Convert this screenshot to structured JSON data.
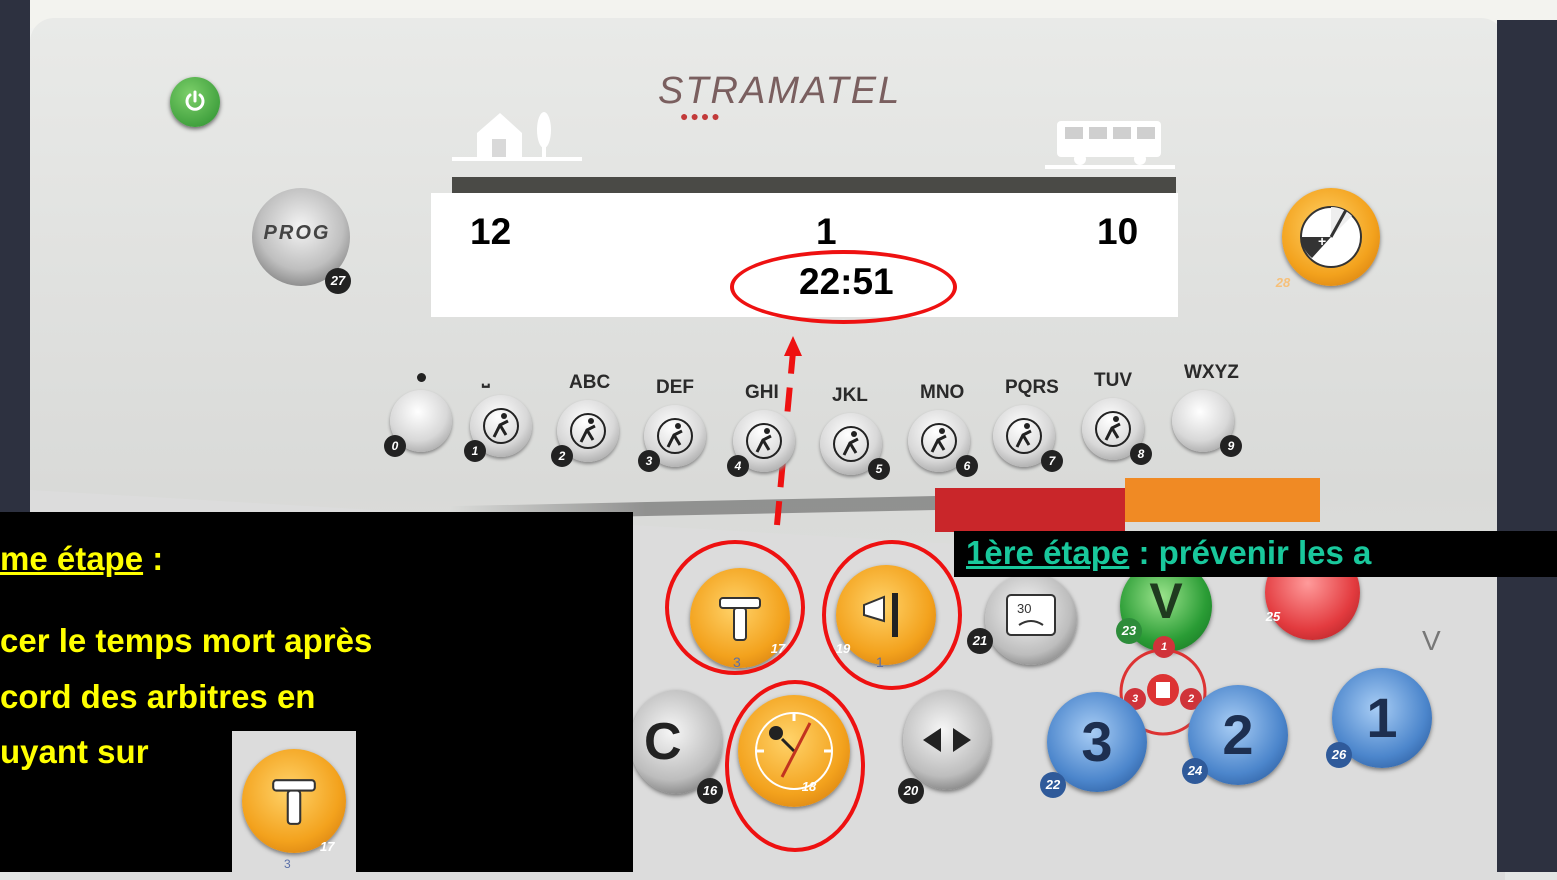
{
  "brand": "STRAMATEL",
  "buttons": {
    "prog_label": "PROG",
    "prog_num": "27",
    "shot_clock_num": "28",
    "clear_label": "C",
    "clear_num": "16",
    "clock_num": "18",
    "arrows_num": "20",
    "timeout_num": "17",
    "timeout_sub": "3",
    "horn_num": "19",
    "horn_sub": "1",
    "display_num": "21",
    "display_text": "30",
    "validate_label": "V",
    "validate_num": "23",
    "red_num": "25",
    "team3_label": "3",
    "team3_num": "22",
    "team2_label": "2",
    "team2_num": "24",
    "team1_label": "1",
    "team1_num": "26",
    "small_v": "V"
  },
  "scoreboard": {
    "home_score": "12",
    "period": "1",
    "guest_score": "10",
    "time": "22:51"
  },
  "keypad": [
    {
      "letters": "",
      "num": "0"
    },
    {
      "letters": "⎵",
      "num": "1"
    },
    {
      "letters": "ABC",
      "num": "2"
    },
    {
      "letters": "DEF",
      "num": "3"
    },
    {
      "letters": "GHI",
      "num": "4"
    },
    {
      "letters": "JKL",
      "num": "5"
    },
    {
      "letters": "MNO",
      "num": "6"
    },
    {
      "letters": "PQRS",
      "num": "7"
    },
    {
      "letters": "TUV",
      "num": "8"
    },
    {
      "letters": "WXYZ",
      "num": "9"
    }
  ],
  "fouls": {
    "top": "1",
    "left": "3",
    "right": "2"
  },
  "overlay": {
    "step2_title": "me étape",
    "step2_colon": " :",
    "step2_line1": "cer le temps mort après",
    "step2_line2": "cord des arbitres en",
    "step2_line3": "uyant sur",
    "step1_title": "1ère étape",
    "step1_rest": " : prévenir les a"
  },
  "colors": {
    "highlight_red": "#e11111",
    "instruction_yellow": "#ffff00",
    "step1_teal": "#19c89c",
    "button_orange": "#f3a21d"
  }
}
